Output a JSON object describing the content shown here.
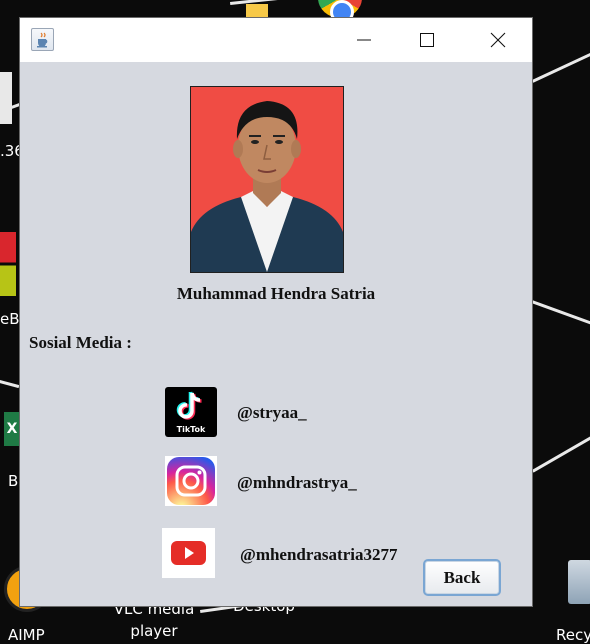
{
  "desktop": {
    "labels": [
      "VLC media player",
      "Desktop",
      ".36",
      "eB",
      "B",
      "AIMP",
      "Recy"
    ]
  },
  "window": {
    "icon": "java-cup-icon",
    "controls": {
      "minimize": "minimize-icon",
      "maximize": "maximize-icon",
      "close": "close-icon"
    }
  },
  "profile": {
    "name": "Muhammad Hendra Satria"
  },
  "social": {
    "heading": "Sosial Media :",
    "items": [
      {
        "platform": "TikTok",
        "icon": "tiktok-icon",
        "handle": "@stryaa_",
        "icon_text": "TikTok"
      },
      {
        "platform": "Instagram",
        "icon": "instagram-icon",
        "handle": "@mhndrastrya_"
      },
      {
        "platform": "YouTube",
        "icon": "youtube-icon",
        "handle": "@mhendrasatria3277"
      }
    ]
  },
  "actions": {
    "back_label": "Back"
  },
  "colors": {
    "window_bg": "#d6d9e0",
    "photo_bg": "#f04c44",
    "button_border": "#7aa6d3"
  }
}
